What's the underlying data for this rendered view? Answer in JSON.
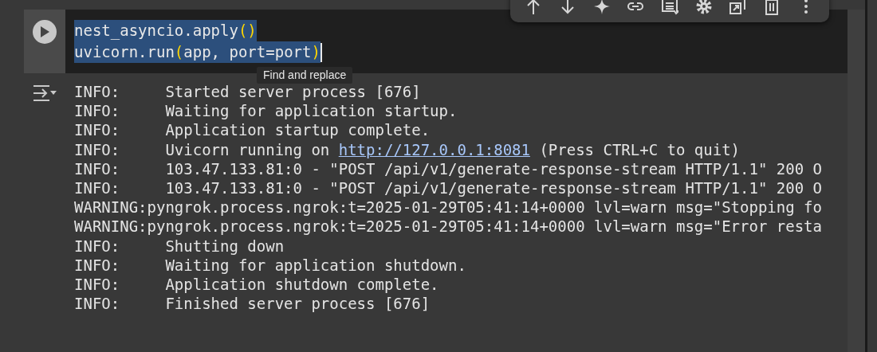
{
  "code_cell": {
    "lines": [
      {
        "selected": true,
        "parts": [
          {
            "kind": "plain",
            "text": "nest_asyncio.apply"
          },
          {
            "kind": "paren",
            "text": "()"
          }
        ]
      },
      {
        "selected": true,
        "parts": [
          {
            "kind": "plain",
            "text": "uvicorn.run"
          },
          {
            "kind": "paren",
            "text": "("
          },
          {
            "kind": "plain",
            "text": "app, port=port"
          },
          {
            "kind": "paren",
            "text": ")"
          }
        ]
      }
    ]
  },
  "toolbar": {
    "buttons": [
      {
        "kind": "move-up"
      },
      {
        "kind": "move-down"
      },
      {
        "kind": "generate"
      },
      {
        "kind": "link"
      },
      {
        "kind": "comment"
      },
      {
        "kind": "settings"
      },
      {
        "kind": "mirror"
      },
      {
        "kind": "delete"
      },
      {
        "kind": "more"
      }
    ]
  },
  "tooltip": "Find and replace",
  "output": {
    "lines": [
      {
        "parts": [
          {
            "kind": "text",
            "text": "INFO:     Started server process [676]"
          }
        ]
      },
      {
        "parts": [
          {
            "kind": "text",
            "text": "INFO:     Waiting for application startup."
          }
        ]
      },
      {
        "parts": [
          {
            "kind": "text",
            "text": "INFO:     Application startup complete."
          }
        ]
      },
      {
        "parts": [
          {
            "kind": "text",
            "text": "INFO:     Uvicorn running on "
          },
          {
            "kind": "link",
            "text": "http://127.0.0.1:8081"
          },
          {
            "kind": "text",
            "text": " (Press CTRL+C to quit)"
          }
        ]
      },
      {
        "parts": [
          {
            "kind": "text",
            "text": "INFO:     103.47.133.81:0 - \"POST /api/v1/generate-response-stream HTTP/1.1\" 200 O"
          }
        ]
      },
      {
        "parts": [
          {
            "kind": "text",
            "text": "INFO:     103.47.133.81:0 - \"POST /api/v1/generate-response-stream HTTP/1.1\" 200 O"
          }
        ]
      },
      {
        "parts": [
          {
            "kind": "text",
            "text": "WARNING:pyngrok.process.ngrok:t=2025-01-29T05:41:14+0000 lvl=warn msg=\"Stopping fo"
          }
        ]
      },
      {
        "parts": [
          {
            "kind": "text",
            "text": "WARNING:pyngrok.process.ngrok:t=2025-01-29T05:41:14+0000 lvl=warn msg=\"Error resta"
          }
        ]
      },
      {
        "parts": [
          {
            "kind": "text",
            "text": "INFO:     Shutting down"
          }
        ]
      },
      {
        "parts": [
          {
            "kind": "text",
            "text": "INFO:     Waiting for application shutdown."
          }
        ]
      },
      {
        "parts": [
          {
            "kind": "text",
            "text": "INFO:     Application shutdown complete."
          }
        ]
      },
      {
        "parts": [
          {
            "kind": "text",
            "text": "INFO:     Finished server process [676]"
          }
        ]
      }
    ]
  }
}
